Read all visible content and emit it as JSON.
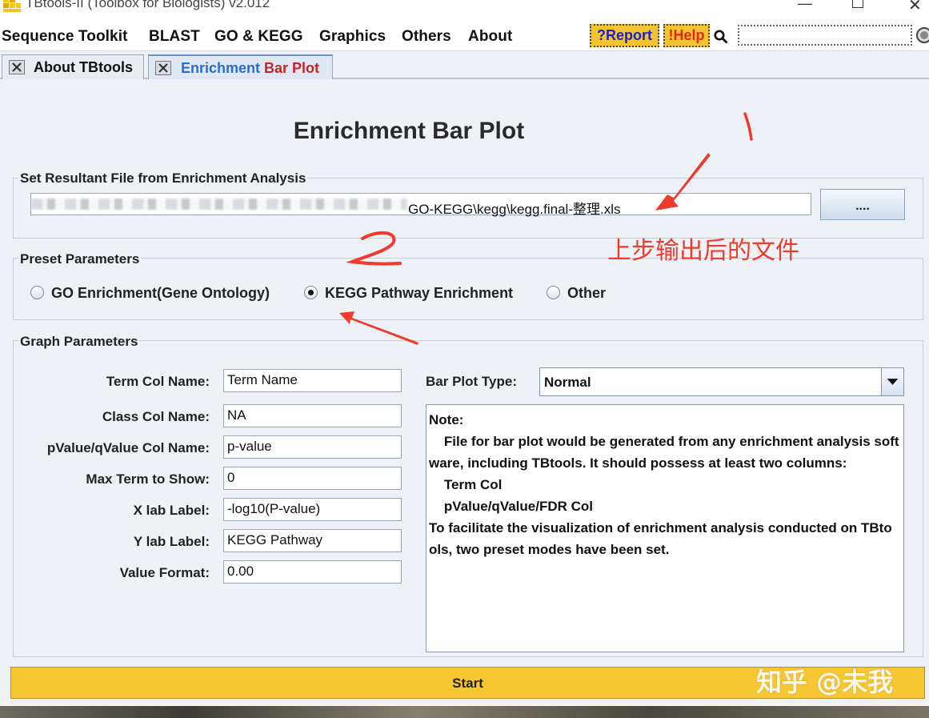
{
  "window": {
    "title": "TBtools-II (Toolbox for Biologists) v2.012"
  },
  "menu": {
    "items": [
      "Sequence Toolkit",
      "BLAST",
      "GO & KEGG",
      "Graphics",
      "Others",
      "About"
    ],
    "report_label": "?Report",
    "help_label": "!Help",
    "search_value": ""
  },
  "tabs": [
    {
      "label": "About TBtools"
    },
    {
      "label_part1": "Enrichment",
      "label_part2": " Bar Plot"
    }
  ],
  "page": {
    "title": "Enrichment Bar Plot"
  },
  "file_group": {
    "title": "Set Resultant File from Enrichment Analysis",
    "path_visible": "GO-KEGG\\kegg\\kegg.final-整理.xls",
    "browse_label": "...."
  },
  "preset_group": {
    "title": "Preset Parameters",
    "options": [
      {
        "label": "GO Enrichment(Gene Ontology)",
        "selected": false
      },
      {
        "label": "KEGG Pathway Enrichment",
        "selected": true
      },
      {
        "label": "Other",
        "selected": false
      }
    ]
  },
  "graph_group": {
    "title": "Graph Parameters",
    "fields": [
      {
        "label": "Term Col Name:",
        "value": "Term Name"
      },
      {
        "label": "Class Col Name:",
        "value": "NA"
      },
      {
        "label": "pValue/qValue Col Name:",
        "value": "p-value"
      },
      {
        "label": "Max Term to Show:",
        "value": "0"
      },
      {
        "label": "X lab Label:",
        "value": "-log10(P-value)"
      },
      {
        "label": "Y lab Label:",
        "value": "KEGG Pathway"
      },
      {
        "label": "Value Format:",
        "value": "0.00"
      }
    ],
    "bar_type_label": "Bar Plot Type:",
    "bar_type_value": "Normal",
    "note_text": "Note:\n    File for bar plot would be generated from any enrichment analysis software, including TBtools. It should possess at least two columns:\n    Term Col\n    pValue/qValue/FDR Col\nTo facilitate the visualization of enrichment analysis conducted on TBtools, two preset modes have been set."
  },
  "start_label": "Start",
  "annotations": {
    "mark_1": "1",
    "caption": "上步输出后的文件",
    "color": "#ef3b2d"
  },
  "watermark": "知乎 @未我"
}
